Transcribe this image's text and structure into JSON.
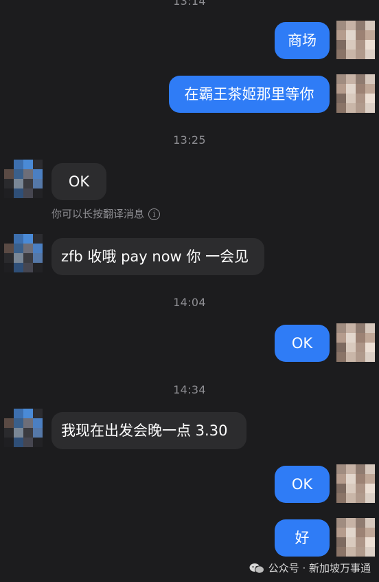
{
  "timestamps": {
    "top": "13:14",
    "t1": "13:25",
    "t2": "14:04",
    "t3": "14:34"
  },
  "messages": {
    "m1": "商场",
    "m2": "在霸王茶姬那里等你",
    "m3": "OK",
    "m4": "zfb 收哦 pay now 你 一会见",
    "m5": "OK",
    "m6": "我现在出发会晚一点 3.30",
    "m7": "OK",
    "m8": "好"
  },
  "translate_hint": "你可以长按翻译消息",
  "watermark": {
    "text": "公众号 · 新加坡万事通",
    "icon": "wechat-icon"
  },
  "colors": {
    "background": "#1c1c1e",
    "outgoing_bubble": "#2f7cf6",
    "incoming_bubble": "#2c2c2e",
    "timestamp_text": "#8e8e93"
  },
  "avatars": {
    "sender_avatar": "pixelated blue avatar",
    "self_avatar": "pixelated beige avatar"
  }
}
